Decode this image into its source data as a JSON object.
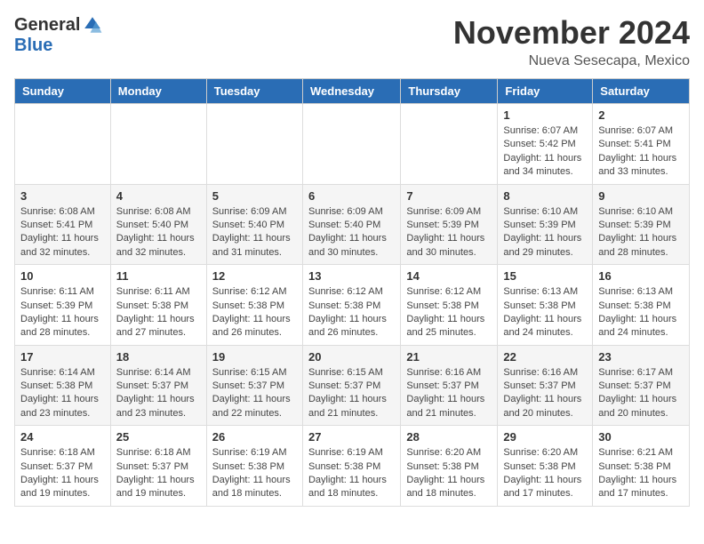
{
  "logo": {
    "general": "General",
    "blue": "Blue"
  },
  "header": {
    "month": "November 2024",
    "location": "Nueva Sesecapa, Mexico"
  },
  "days_of_week": [
    "Sunday",
    "Monday",
    "Tuesday",
    "Wednesday",
    "Thursday",
    "Friday",
    "Saturday"
  ],
  "weeks": [
    [
      {
        "day": "",
        "info": ""
      },
      {
        "day": "",
        "info": ""
      },
      {
        "day": "",
        "info": ""
      },
      {
        "day": "",
        "info": ""
      },
      {
        "day": "",
        "info": ""
      },
      {
        "day": "1",
        "info": "Sunrise: 6:07 AM\nSunset: 5:42 PM\nDaylight: 11 hours and 34 minutes."
      },
      {
        "day": "2",
        "info": "Sunrise: 6:07 AM\nSunset: 5:41 PM\nDaylight: 11 hours and 33 minutes."
      }
    ],
    [
      {
        "day": "3",
        "info": "Sunrise: 6:08 AM\nSunset: 5:41 PM\nDaylight: 11 hours and 32 minutes."
      },
      {
        "day": "4",
        "info": "Sunrise: 6:08 AM\nSunset: 5:40 PM\nDaylight: 11 hours and 32 minutes."
      },
      {
        "day": "5",
        "info": "Sunrise: 6:09 AM\nSunset: 5:40 PM\nDaylight: 11 hours and 31 minutes."
      },
      {
        "day": "6",
        "info": "Sunrise: 6:09 AM\nSunset: 5:40 PM\nDaylight: 11 hours and 30 minutes."
      },
      {
        "day": "7",
        "info": "Sunrise: 6:09 AM\nSunset: 5:39 PM\nDaylight: 11 hours and 30 minutes."
      },
      {
        "day": "8",
        "info": "Sunrise: 6:10 AM\nSunset: 5:39 PM\nDaylight: 11 hours and 29 minutes."
      },
      {
        "day": "9",
        "info": "Sunrise: 6:10 AM\nSunset: 5:39 PM\nDaylight: 11 hours and 28 minutes."
      }
    ],
    [
      {
        "day": "10",
        "info": "Sunrise: 6:11 AM\nSunset: 5:39 PM\nDaylight: 11 hours and 28 minutes."
      },
      {
        "day": "11",
        "info": "Sunrise: 6:11 AM\nSunset: 5:38 PM\nDaylight: 11 hours and 27 minutes."
      },
      {
        "day": "12",
        "info": "Sunrise: 6:12 AM\nSunset: 5:38 PM\nDaylight: 11 hours and 26 minutes."
      },
      {
        "day": "13",
        "info": "Sunrise: 6:12 AM\nSunset: 5:38 PM\nDaylight: 11 hours and 26 minutes."
      },
      {
        "day": "14",
        "info": "Sunrise: 6:12 AM\nSunset: 5:38 PM\nDaylight: 11 hours and 25 minutes."
      },
      {
        "day": "15",
        "info": "Sunrise: 6:13 AM\nSunset: 5:38 PM\nDaylight: 11 hours and 24 minutes."
      },
      {
        "day": "16",
        "info": "Sunrise: 6:13 AM\nSunset: 5:38 PM\nDaylight: 11 hours and 24 minutes."
      }
    ],
    [
      {
        "day": "17",
        "info": "Sunrise: 6:14 AM\nSunset: 5:38 PM\nDaylight: 11 hours and 23 minutes."
      },
      {
        "day": "18",
        "info": "Sunrise: 6:14 AM\nSunset: 5:37 PM\nDaylight: 11 hours and 23 minutes."
      },
      {
        "day": "19",
        "info": "Sunrise: 6:15 AM\nSunset: 5:37 PM\nDaylight: 11 hours and 22 minutes."
      },
      {
        "day": "20",
        "info": "Sunrise: 6:15 AM\nSunset: 5:37 PM\nDaylight: 11 hours and 21 minutes."
      },
      {
        "day": "21",
        "info": "Sunrise: 6:16 AM\nSunset: 5:37 PM\nDaylight: 11 hours and 21 minutes."
      },
      {
        "day": "22",
        "info": "Sunrise: 6:16 AM\nSunset: 5:37 PM\nDaylight: 11 hours and 20 minutes."
      },
      {
        "day": "23",
        "info": "Sunrise: 6:17 AM\nSunset: 5:37 PM\nDaylight: 11 hours and 20 minutes."
      }
    ],
    [
      {
        "day": "24",
        "info": "Sunrise: 6:18 AM\nSunset: 5:37 PM\nDaylight: 11 hours and 19 minutes."
      },
      {
        "day": "25",
        "info": "Sunrise: 6:18 AM\nSunset: 5:37 PM\nDaylight: 11 hours and 19 minutes."
      },
      {
        "day": "26",
        "info": "Sunrise: 6:19 AM\nSunset: 5:38 PM\nDaylight: 11 hours and 18 minutes."
      },
      {
        "day": "27",
        "info": "Sunrise: 6:19 AM\nSunset: 5:38 PM\nDaylight: 11 hours and 18 minutes."
      },
      {
        "day": "28",
        "info": "Sunrise: 6:20 AM\nSunset: 5:38 PM\nDaylight: 11 hours and 18 minutes."
      },
      {
        "day": "29",
        "info": "Sunrise: 6:20 AM\nSunset: 5:38 PM\nDaylight: 11 hours and 17 minutes."
      },
      {
        "day": "30",
        "info": "Sunrise: 6:21 AM\nSunset: 5:38 PM\nDaylight: 11 hours and 17 minutes."
      }
    ]
  ]
}
